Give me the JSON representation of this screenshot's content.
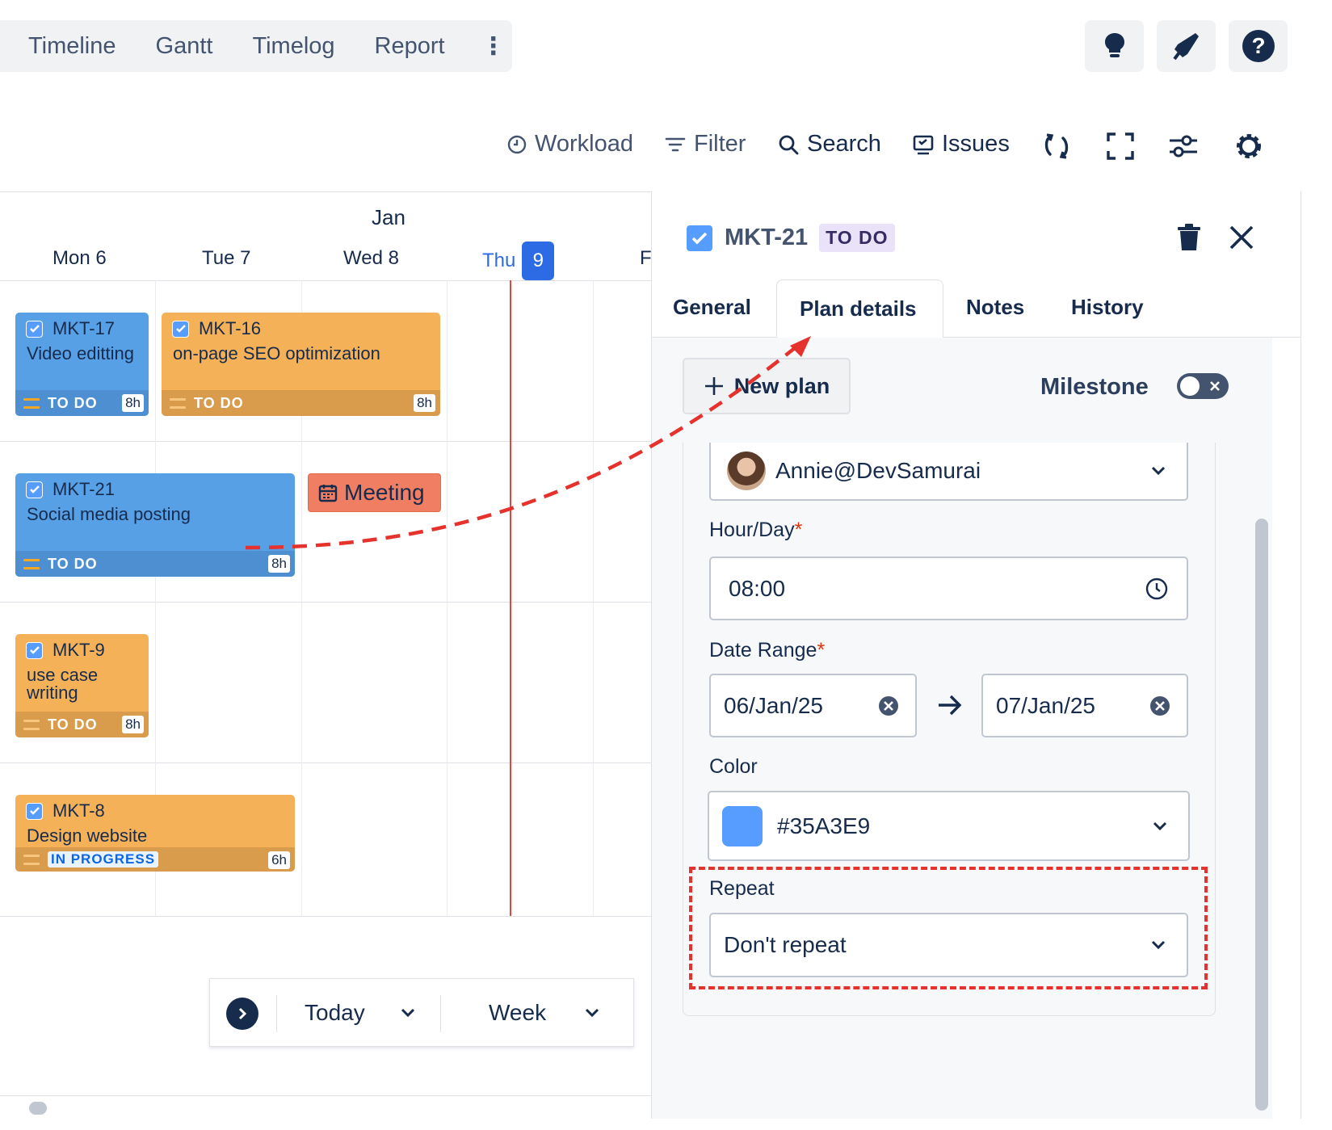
{
  "topnav": {
    "tabs": [
      "Timeline",
      "Gantt",
      "Timelog",
      "Report"
    ]
  },
  "toolbar": {
    "workload": "Workload",
    "filter": "Filter",
    "search": "Search",
    "issues": "Issues"
  },
  "calendar": {
    "month": "Jan",
    "days": [
      {
        "name": "Mon",
        "num": "6"
      },
      {
        "name": "Tue",
        "num": "7"
      },
      {
        "name": "Wed",
        "num": "8"
      },
      {
        "name": "Thu",
        "num": "9"
      },
      {
        "name": "F",
        "num": ""
      }
    ],
    "cards": [
      {
        "key": "MKT-17",
        "title": "Video editting",
        "status": "TO DO",
        "hours": "8h"
      },
      {
        "key": "MKT-16",
        "title": "on-page SEO optimization",
        "status": "TO DO",
        "hours": "8h"
      },
      {
        "key": "MKT-21",
        "title": "Social media posting",
        "status": "TO DO",
        "hours": "8h"
      },
      {
        "key": "MKT-9",
        "title": "use case writing",
        "status": "TO DO",
        "hours": "8h"
      },
      {
        "key": "MKT-8",
        "title": "Design website",
        "status": "IN PROGRESS",
        "hours": "6h"
      }
    ],
    "meeting": "Meeting",
    "today_label": "Today",
    "view_label": "Week"
  },
  "panel": {
    "issue_key": "MKT-21",
    "status": "TO DO",
    "tabs": [
      "General",
      "Plan details",
      "Notes",
      "History"
    ],
    "active_tab": "Plan details",
    "new_plan": "New plan",
    "milestone": "Milestone",
    "assignee": "Annie@DevSamurai",
    "hour_day_label": "Hour/Day",
    "hour_day_value": "08:00",
    "date_range_label": "Date Range",
    "date_start": "06/Jan/25",
    "date_end": "07/Jan/25",
    "color_label": "Color",
    "color_value": "#35A3E9",
    "repeat_label": "Repeat",
    "repeat_value": "Don't repeat",
    "required_mark": "*"
  },
  "colors": {
    "blue_card": "#57a0e6",
    "orange_card": "#f4b157",
    "meeting": "#f07e62",
    "today_badge": "#2d6be4",
    "annotation": "#e5322d",
    "swatch": "#579dff"
  }
}
